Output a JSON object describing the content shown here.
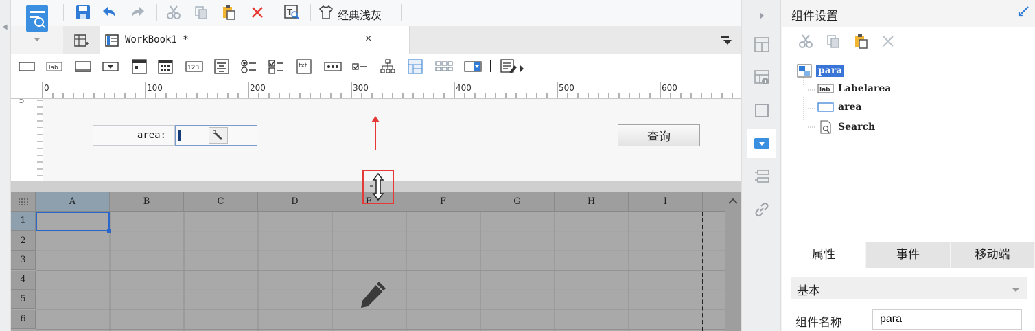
{
  "toolbar": {
    "buttons": [
      "save-icon",
      "undo-icon",
      "redo-icon",
      "cut-icon",
      "copy-icon",
      "paste-icon",
      "delete-icon",
      "text-search-icon",
      "theme-shirt-icon"
    ],
    "theme_label": "经典浅灰"
  },
  "tab": {
    "title": "WorkBook1 *",
    "close": "×"
  },
  "widgets": [
    "textbox",
    "label",
    "button",
    "combobox",
    "list",
    "date",
    "number",
    "textarea",
    "radio-group",
    "checkbox-group",
    "file",
    "password",
    "checkbox",
    "tree",
    "tree-combobox",
    "tab-label",
    "combocheckbox",
    "more"
  ],
  "ruler": {
    "labels": [
      "0",
      "100",
      "200",
      "300",
      "400",
      "500",
      "600"
    ],
    "vertical_label": "0"
  },
  "para": {
    "label_text": "area:",
    "query_button": "查询"
  },
  "sheet": {
    "columns": [
      "A",
      "B",
      "C",
      "D",
      "E",
      "F",
      "G",
      "H",
      "I"
    ],
    "rows": [
      "1",
      "2",
      "3",
      "4",
      "5",
      "6"
    ],
    "selected_cell": "A1"
  },
  "panel": {
    "title": "组件设置",
    "tree": {
      "root": "para",
      "children": [
        "Labelarea",
        "area",
        "Search"
      ]
    },
    "tabs": [
      "属性",
      "事件",
      "移动端"
    ],
    "active_tab": "属性",
    "section": "基本",
    "name_label": "组件名称",
    "name_value": "para"
  },
  "colors": {
    "accent": "#3875d7",
    "highlight_red": "#e53935",
    "sheet_bg": "#a9a9a9"
  }
}
